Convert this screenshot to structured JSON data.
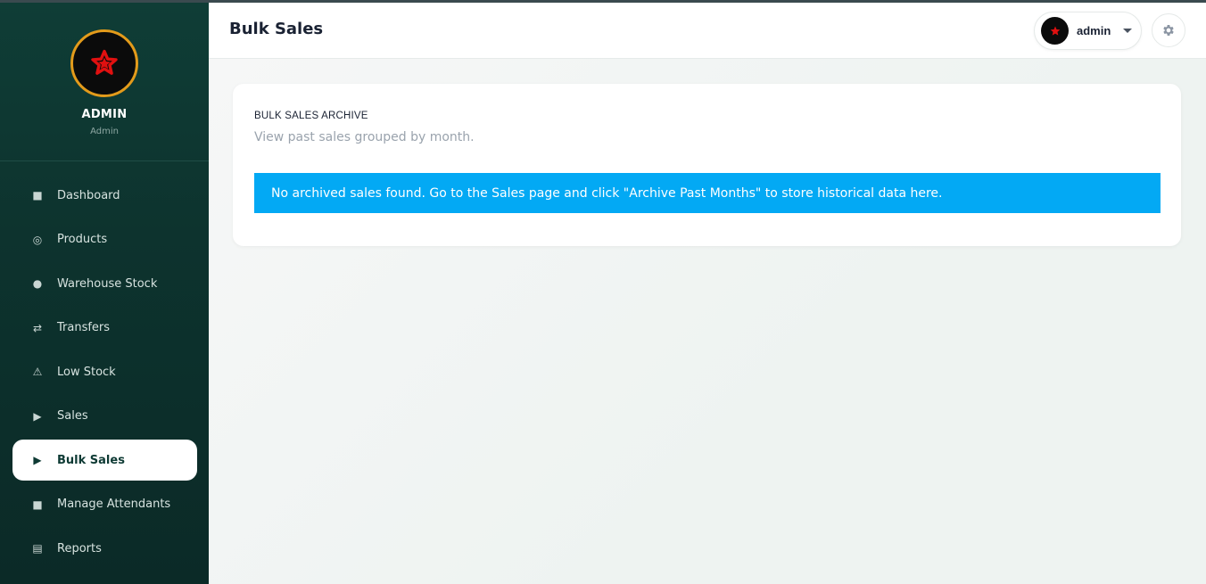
{
  "profile": {
    "name": "ADMIN",
    "role": "Admin"
  },
  "nav": {
    "items": [
      {
        "label": "Dashboard",
        "icon": "square-icon",
        "glyph": "■"
      },
      {
        "label": "Products",
        "icon": "target-icon",
        "glyph": "◎"
      },
      {
        "label": "Warehouse Stock",
        "icon": "dot-icon",
        "glyph": "●"
      },
      {
        "label": "Transfers",
        "icon": "transfer-arrows-icon",
        "glyph": "⇄"
      },
      {
        "label": "Low Stock",
        "icon": "warning-icon",
        "glyph": "⚠"
      },
      {
        "label": "Sales",
        "icon": "play-icon",
        "glyph": "▶"
      },
      {
        "label": "Bulk Sales",
        "icon": "play-icon",
        "glyph": "▶",
        "active": true
      },
      {
        "label": "Manage Attendants",
        "icon": "square-icon",
        "glyph": "■"
      },
      {
        "label": "Reports",
        "icon": "list-icon",
        "glyph": "▤"
      }
    ]
  },
  "header": {
    "title": "Bulk Sales",
    "user": "admin"
  },
  "card": {
    "title": "BULK SALES ARCHIVE",
    "subtitle": "View past sales grouped by month.",
    "alert": "No archived sales found. Go to the Sales page and click \"Archive Past Months\" to store historical data here."
  },
  "colors": {
    "sidebar": "#0f3d36",
    "avatar_ring": "#e39b1b",
    "alert_bg": "#03a9f4",
    "star": "#e01010"
  }
}
